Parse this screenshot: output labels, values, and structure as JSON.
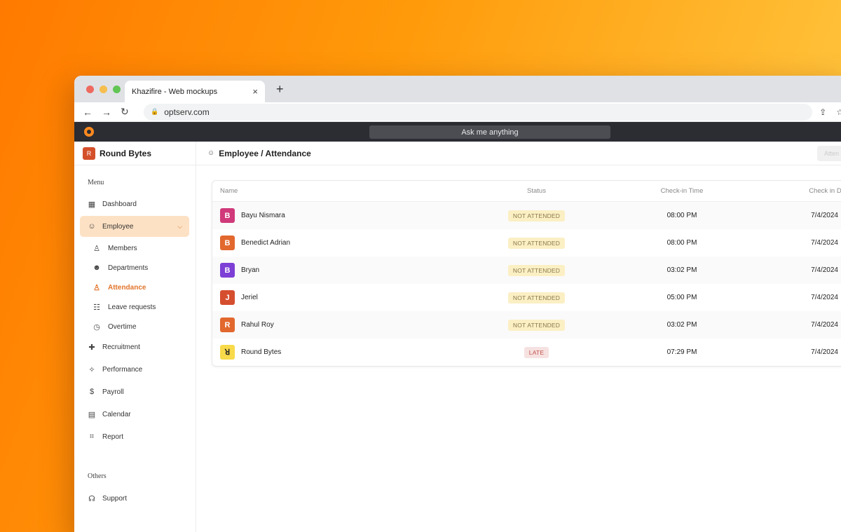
{
  "browser": {
    "tab_title": "Khazifire - Web mockups",
    "tab_close": "×",
    "new_tab": "+",
    "url": "optserv.com",
    "nav": {
      "back": "←",
      "forward": "→",
      "reload": "↻"
    },
    "share": "⇪",
    "star": "☆"
  },
  "app": {
    "search_placeholder": "Ask me anything",
    "brand": {
      "initial": "R",
      "name": "Round Bytes"
    },
    "breadcrumb": "Employee / Attendance",
    "header_button": "Atten"
  },
  "sidebar": {
    "menu_label": "Menu",
    "others_label": "Others",
    "items": {
      "dashboard": "Dashboard",
      "employee": "Employee",
      "recruitment": "Recruitment",
      "performance": "Performance",
      "payroll": "Payroll",
      "calendar": "Calendar",
      "report": "Report",
      "support": "Support"
    },
    "sub_items": {
      "members": "Members",
      "departments": "Departments",
      "attendance": "Attendance",
      "leave_requests": "Leave requests",
      "overtime": "Overtime"
    }
  },
  "table": {
    "headers": {
      "name": "Name",
      "status": "Status",
      "checkin_time": "Check-in Time",
      "checkin_date": "Check in Da"
    },
    "rows": [
      {
        "initial": "B",
        "name": "Bayu Nismara",
        "status": "NOT ATTENDED",
        "time": "08:00 PM",
        "date": "7/4/2024",
        "avatar_color": "#d0397a"
      },
      {
        "initial": "B",
        "name": "Benedict Adrian",
        "status": "NOT ATTENDED",
        "time": "08:00 PM",
        "date": "7/4/2024",
        "avatar_color": "#e2682e"
      },
      {
        "initial": "B",
        "name": "Bryan",
        "status": "NOT ATTENDED",
        "time": "03:02 PM",
        "date": "7/4/2024",
        "avatar_color": "#7d3fd6"
      },
      {
        "initial": "J",
        "name": "Jeriel",
        "status": "NOT ATTENDED",
        "time": "05:00 PM",
        "date": "7/4/2024",
        "avatar_color": "#d54e2e"
      },
      {
        "initial": "R",
        "name": "Rahul Roy",
        "status": "NOT ATTENDED",
        "time": "03:02 PM",
        "date": "7/4/2024",
        "avatar_color": "#e2682e"
      },
      {
        "initial": "ꓤ",
        "name": "Round Bytes",
        "status": "LATE",
        "time": "07:29 PM",
        "date": "7/4/2024",
        "avatar_color": "#f8da4a"
      }
    ]
  },
  "colors": {
    "accent": "#e2752b",
    "active_bg": "#fde1c4",
    "header_dark": "#2b2d33"
  }
}
